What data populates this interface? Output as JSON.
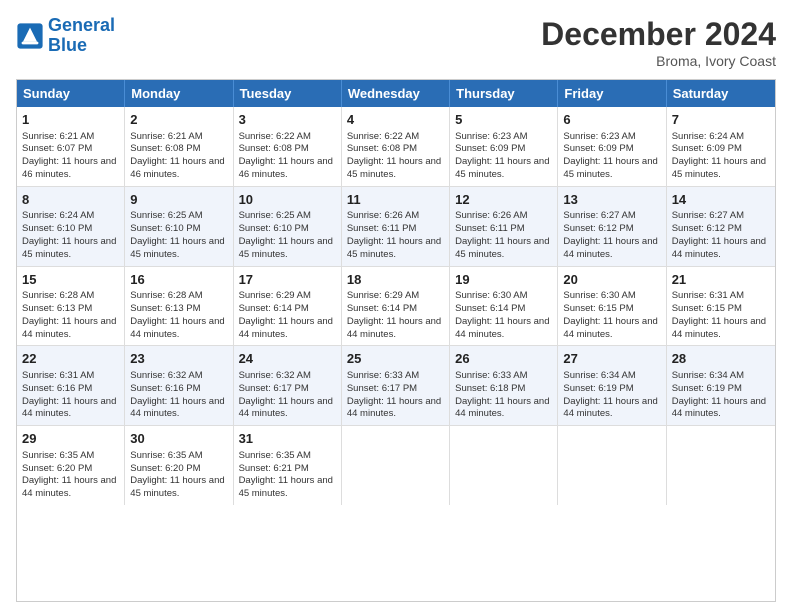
{
  "header": {
    "logo_line1": "General",
    "logo_line2": "Blue",
    "month_title": "December 2024",
    "subtitle": "Broma, Ivory Coast"
  },
  "days_of_week": [
    "Sunday",
    "Monday",
    "Tuesday",
    "Wednesday",
    "Thursday",
    "Friday",
    "Saturday"
  ],
  "weeks": [
    [
      {
        "day": "1",
        "sunrise": "6:21 AM",
        "sunset": "6:07 PM",
        "daylight": "11 hours and 46 minutes."
      },
      {
        "day": "2",
        "sunrise": "6:21 AM",
        "sunset": "6:08 PM",
        "daylight": "11 hours and 46 minutes."
      },
      {
        "day": "3",
        "sunrise": "6:22 AM",
        "sunset": "6:08 PM",
        "daylight": "11 hours and 46 minutes."
      },
      {
        "day": "4",
        "sunrise": "6:22 AM",
        "sunset": "6:08 PM",
        "daylight": "11 hours and 45 minutes."
      },
      {
        "day": "5",
        "sunrise": "6:23 AM",
        "sunset": "6:09 PM",
        "daylight": "11 hours and 45 minutes."
      },
      {
        "day": "6",
        "sunrise": "6:23 AM",
        "sunset": "6:09 PM",
        "daylight": "11 hours and 45 minutes."
      },
      {
        "day": "7",
        "sunrise": "6:24 AM",
        "sunset": "6:09 PM",
        "daylight": "11 hours and 45 minutes."
      }
    ],
    [
      {
        "day": "8",
        "sunrise": "6:24 AM",
        "sunset": "6:10 PM",
        "daylight": "11 hours and 45 minutes."
      },
      {
        "day": "9",
        "sunrise": "6:25 AM",
        "sunset": "6:10 PM",
        "daylight": "11 hours and 45 minutes."
      },
      {
        "day": "10",
        "sunrise": "6:25 AM",
        "sunset": "6:10 PM",
        "daylight": "11 hours and 45 minutes."
      },
      {
        "day": "11",
        "sunrise": "6:26 AM",
        "sunset": "6:11 PM",
        "daylight": "11 hours and 45 minutes."
      },
      {
        "day": "12",
        "sunrise": "6:26 AM",
        "sunset": "6:11 PM",
        "daylight": "11 hours and 45 minutes."
      },
      {
        "day": "13",
        "sunrise": "6:27 AM",
        "sunset": "6:12 PM",
        "daylight": "11 hours and 44 minutes."
      },
      {
        "day": "14",
        "sunrise": "6:27 AM",
        "sunset": "6:12 PM",
        "daylight": "11 hours and 44 minutes."
      }
    ],
    [
      {
        "day": "15",
        "sunrise": "6:28 AM",
        "sunset": "6:13 PM",
        "daylight": "11 hours and 44 minutes."
      },
      {
        "day": "16",
        "sunrise": "6:28 AM",
        "sunset": "6:13 PM",
        "daylight": "11 hours and 44 minutes."
      },
      {
        "day": "17",
        "sunrise": "6:29 AM",
        "sunset": "6:14 PM",
        "daylight": "11 hours and 44 minutes."
      },
      {
        "day": "18",
        "sunrise": "6:29 AM",
        "sunset": "6:14 PM",
        "daylight": "11 hours and 44 minutes."
      },
      {
        "day": "19",
        "sunrise": "6:30 AM",
        "sunset": "6:14 PM",
        "daylight": "11 hours and 44 minutes."
      },
      {
        "day": "20",
        "sunrise": "6:30 AM",
        "sunset": "6:15 PM",
        "daylight": "11 hours and 44 minutes."
      },
      {
        "day": "21",
        "sunrise": "6:31 AM",
        "sunset": "6:15 PM",
        "daylight": "11 hours and 44 minutes."
      }
    ],
    [
      {
        "day": "22",
        "sunrise": "6:31 AM",
        "sunset": "6:16 PM",
        "daylight": "11 hours and 44 minutes."
      },
      {
        "day": "23",
        "sunrise": "6:32 AM",
        "sunset": "6:16 PM",
        "daylight": "11 hours and 44 minutes."
      },
      {
        "day": "24",
        "sunrise": "6:32 AM",
        "sunset": "6:17 PM",
        "daylight": "11 hours and 44 minutes."
      },
      {
        "day": "25",
        "sunrise": "6:33 AM",
        "sunset": "6:17 PM",
        "daylight": "11 hours and 44 minutes."
      },
      {
        "day": "26",
        "sunrise": "6:33 AM",
        "sunset": "6:18 PM",
        "daylight": "11 hours and 44 minutes."
      },
      {
        "day": "27",
        "sunrise": "6:34 AM",
        "sunset": "6:19 PM",
        "daylight": "11 hours and 44 minutes."
      },
      {
        "day": "28",
        "sunrise": "6:34 AM",
        "sunset": "6:19 PM",
        "daylight": "11 hours and 44 minutes."
      }
    ],
    [
      {
        "day": "29",
        "sunrise": "6:35 AM",
        "sunset": "6:20 PM",
        "daylight": "11 hours and 44 minutes."
      },
      {
        "day": "30",
        "sunrise": "6:35 AM",
        "sunset": "6:20 PM",
        "daylight": "11 hours and 45 minutes."
      },
      {
        "day": "31",
        "sunrise": "6:35 AM",
        "sunset": "6:21 PM",
        "daylight": "11 hours and 45 minutes."
      },
      null,
      null,
      null,
      null
    ]
  ]
}
